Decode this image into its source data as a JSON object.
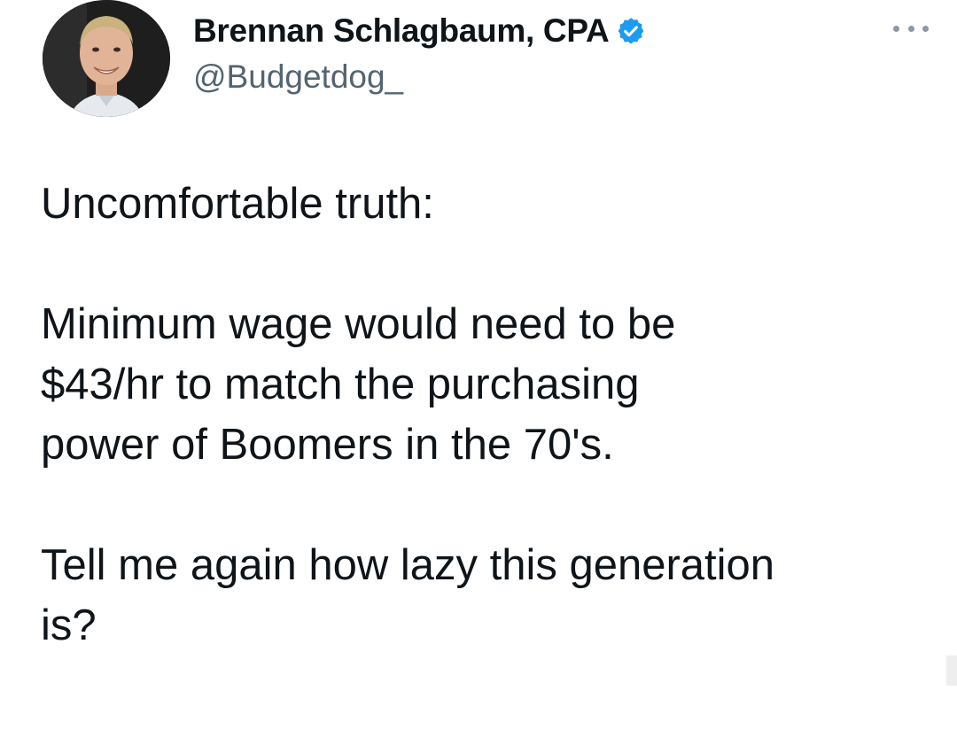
{
  "tweet": {
    "author": {
      "name": "Brennan Schlagbaum, CPA",
      "handle": "@Budgetdog_",
      "verified": true,
      "verified_icon": "verified-badge-icon",
      "verified_color": "#1d9bf0",
      "avatar": "avatar-photo"
    },
    "more_icon": "more-options-icon",
    "paragraphs": [
      "Uncomfortable truth:",
      "Minimum wage would need to be\n$43/hr to match the purchasing\npower of Boomers in the 70's.",
      "Tell me again how lazy this generation\nis?"
    ]
  }
}
